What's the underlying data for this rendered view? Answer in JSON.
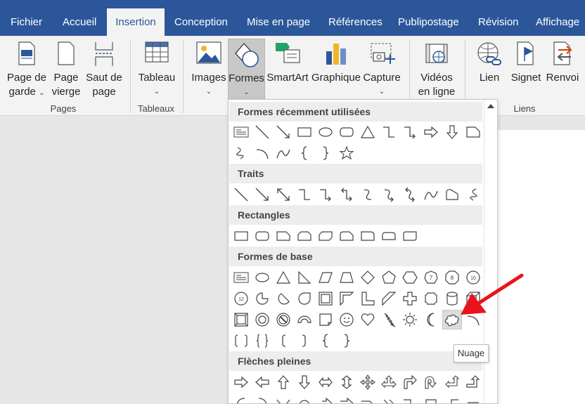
{
  "tabs": [
    {
      "label": "Fichier"
    },
    {
      "label": "Accueil"
    },
    {
      "label": "Insertion"
    },
    {
      "label": "Conception"
    },
    {
      "label": "Mise en page"
    },
    {
      "label": "Références"
    },
    {
      "label": "Publipostage"
    },
    {
      "label": "Révision"
    },
    {
      "label": "Affichage"
    }
  ],
  "active_tab": "Insertion",
  "ribbon": {
    "page_de_garde": "Page de garde",
    "page_vierge": "Page vierge",
    "saut_de_page": "Saut de page",
    "tableau": "Tableau",
    "images": "Images",
    "formes": "Formes",
    "smartart": "SmartArt",
    "graphique": "Graphique",
    "capture": "Capture",
    "videos": "Vidéos en ligne",
    "lien": "Lien",
    "signet": "Signet",
    "renvoi": "Renvoi",
    "group_pages": "Pages",
    "group_tableaux": "Tableaux",
    "group_liens": "Liens"
  },
  "dropdown": {
    "sections": [
      {
        "title": "Formes récemment utilisées"
      },
      {
        "title": "Traits"
      },
      {
        "title": "Rectangles"
      },
      {
        "title": "Formes de base"
      },
      {
        "title": "Flèches pleines"
      }
    ],
    "highlighted_shape": "cloud-shape"
  },
  "tooltip": "Nuage",
  "colors": {
    "accent": "#2b579a",
    "arrow": "#e8141c"
  }
}
